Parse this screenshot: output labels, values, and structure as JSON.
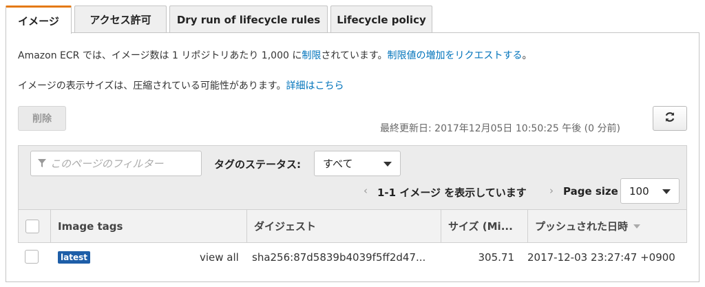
{
  "tabs": [
    {
      "label": "イメージ"
    },
    {
      "label": "アクセス許可"
    },
    {
      "label": "Dry run of lifecycle rules"
    },
    {
      "label": "Lifecycle policy"
    }
  ],
  "notice": {
    "text1": "Amazon ECR では、イメージ数は 1 リポジトリあたり 1,000 に",
    "link1": "制限",
    "text2": "されています。",
    "link2": "制限値の増加をリクエストする",
    "text3": "。"
  },
  "size_note": {
    "text": "イメージの表示サイズは、圧縮されている可能性があります。",
    "link": "詳細はこちら"
  },
  "toolbar": {
    "delete_label": "削除",
    "last_updated": "最終更新日: 2017年12月05日 10:50:25 午後 (0 分前)"
  },
  "filter": {
    "placeholder": "このページのフィルター",
    "tag_status_label": "タグのステータス:",
    "tag_status_value": "すべて"
  },
  "pagination": {
    "range_text": "1-1 イメージ を表示しています",
    "page_size_label": "Page size",
    "page_size_value": "100"
  },
  "table": {
    "columns": [
      "Image tags",
      "ダイジェスト",
      "サイズ (Mi...",
      "プッシュされた日時"
    ],
    "rows": [
      {
        "tag": "latest",
        "view_all": "view all",
        "digest": "sha256:87d5839b4039f5ff2d47...",
        "size": "305.71",
        "pushed_at": "2017-12-03 23:27:47 +0900"
      }
    ]
  },
  "colors": {
    "accent": "#e47911",
    "link": "#0073bb",
    "badge": "#1e5ea8"
  }
}
